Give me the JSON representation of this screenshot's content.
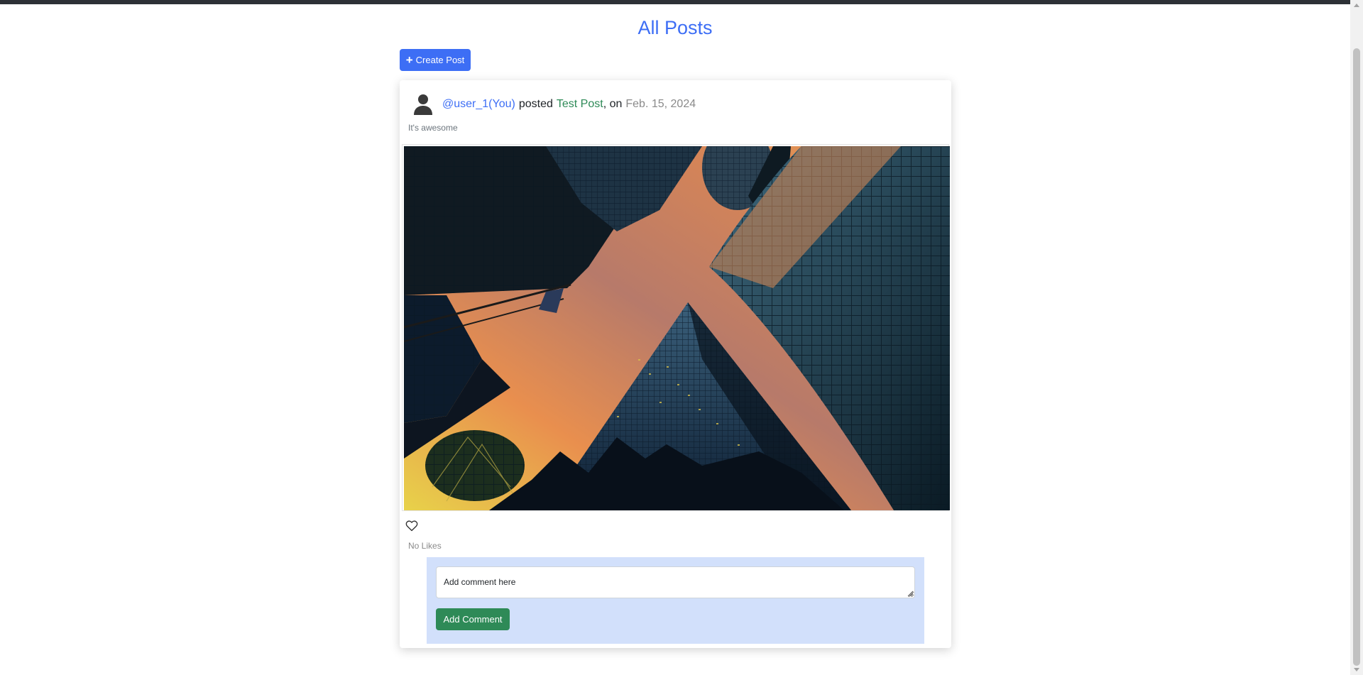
{
  "page": {
    "title": "All Posts",
    "create_button_label": "Create Post"
  },
  "post": {
    "username": "@user_1(You)",
    "posted_text": "posted",
    "title": "Test Post",
    "on_text": ", on",
    "date": "Feb. 15, 2024",
    "description": "It's awesome",
    "likes_text": "No Likes",
    "image_icon": "photo-skyscrapers-looking-up",
    "like_icon": "heart-outline-icon"
  },
  "comment": {
    "placeholder": "Add comment here",
    "button_label": "Add Comment"
  },
  "colors": {
    "accent_blue": "#3d6ef5",
    "accent_green": "#2e8a57",
    "comment_bg": "#d2e0fb"
  }
}
